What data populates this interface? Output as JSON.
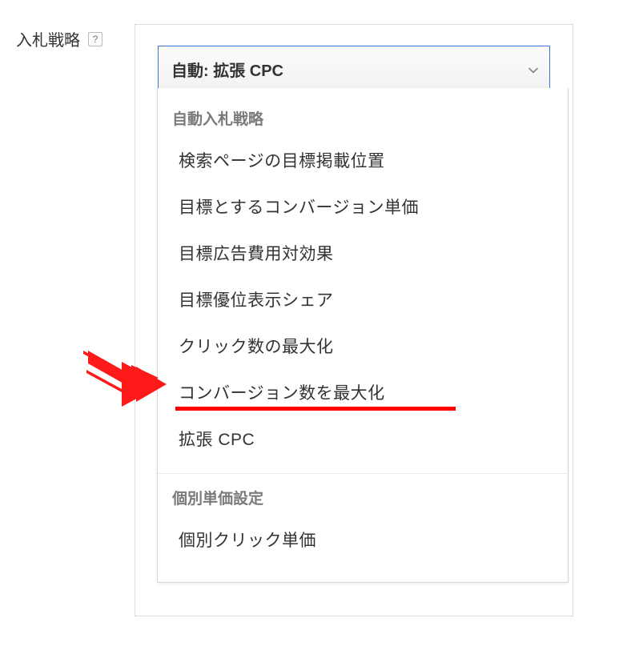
{
  "section_label": "入札戦略",
  "help_glyph": "?",
  "select": {
    "selected_label": "自動: 拡張 CPC"
  },
  "dropdown": {
    "groups": [
      {
        "header": "自動入札戦略",
        "items": [
          {
            "label": "検索ページの目標掲載位置",
            "highlight": false
          },
          {
            "label": "目標とするコンバージョン単価",
            "highlight": false
          },
          {
            "label": "目標広告費用対効果",
            "highlight": false
          },
          {
            "label": "目標優位表示シェア",
            "highlight": false
          },
          {
            "label": "クリック数の最大化",
            "highlight": false
          },
          {
            "label": "コンバージョン数を最大化",
            "highlight": true
          },
          {
            "label": "拡張 CPC",
            "highlight": false
          }
        ]
      },
      {
        "header": "個別単価設定",
        "items": [
          {
            "label": "個別クリック単価",
            "highlight": false
          }
        ]
      }
    ]
  },
  "colors": {
    "accent_border": "#3b7ad9",
    "highlight_underline": "#ff0000",
    "arrow": "#ff1a1a"
  }
}
